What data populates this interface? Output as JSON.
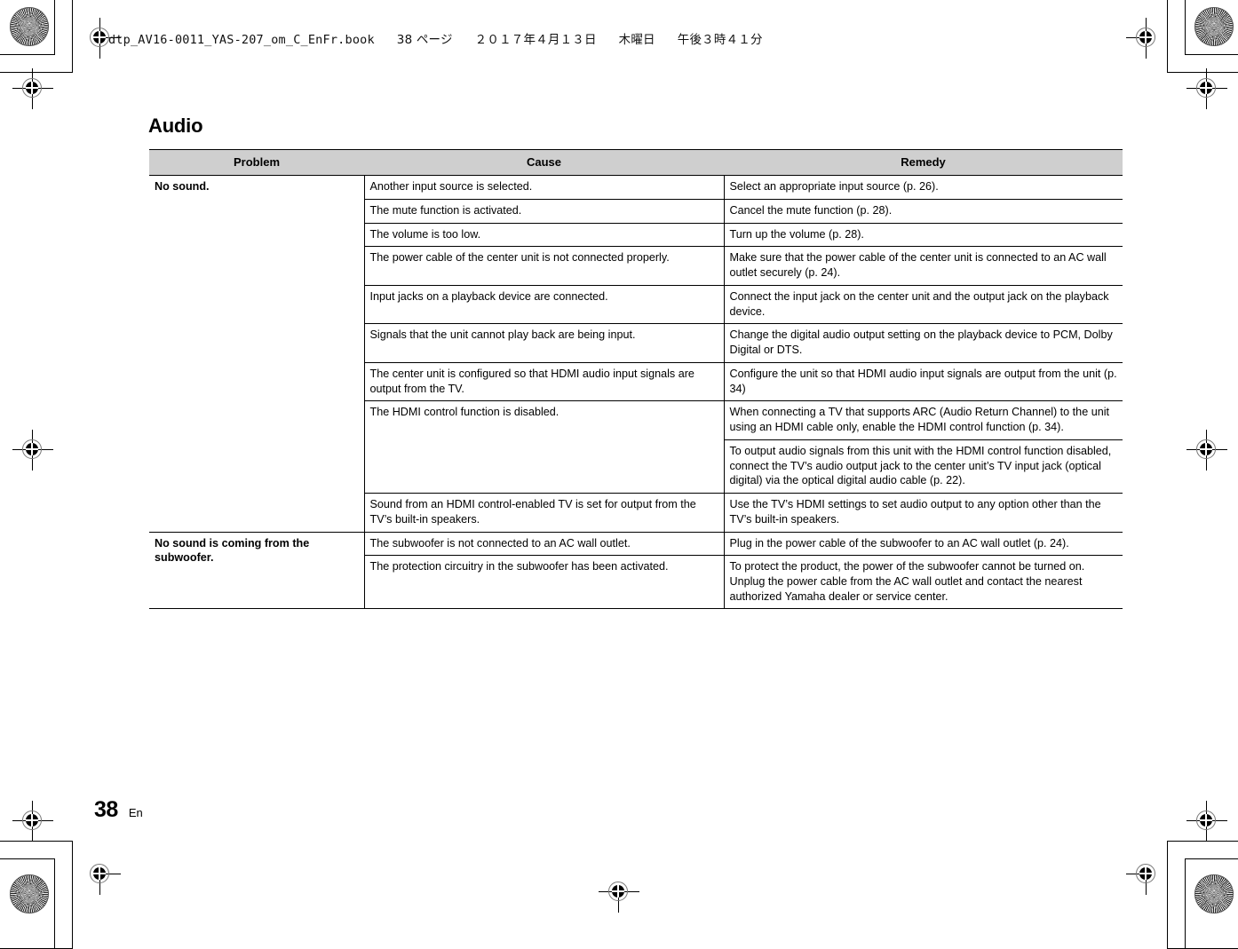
{
  "print_header": {
    "filename": "dtp_AV16-0011_YAS-207_om_C_EnFr.book",
    "page_marker": "38 ページ",
    "date": "２０１７年４月１３日",
    "weekday": "木曜日",
    "time": "午後３時４１分"
  },
  "heading": "Audio",
  "table": {
    "columns": [
      "Problem",
      "Cause",
      "Remedy"
    ],
    "groups": [
      {
        "problem": "No sound.",
        "rows": [
          {
            "cause": "Another input source is selected.",
            "remedy": "Select an appropriate input source (p. 26)."
          },
          {
            "cause": "The mute function is activated.",
            "remedy": "Cancel the mute function (p. 28)."
          },
          {
            "cause": "The volume is too low.",
            "remedy": "Turn up the volume (p. 28)."
          },
          {
            "cause": "The power cable of the center unit is not connected properly.",
            "remedy": "Make sure that the power cable of the center unit is connected to an AC wall outlet securely (p. 24)."
          },
          {
            "cause": "Input jacks on a playback device are connected.",
            "remedy": "Connect the input jack on the center unit and the output jack on the playback device."
          },
          {
            "cause": "Signals that the unit cannot play back are being input.",
            "remedy": "Change the digital audio output setting on the playback device to PCM, Dolby Digital or DTS."
          },
          {
            "cause": "The center unit is configured so that HDMI audio input signals are output from the TV.",
            "remedy": "Configure the unit so that HDMI audio input signals are output from the unit (p. 34)"
          },
          {
            "cause": "The HDMI control function is disabled.",
            "remedy": "When connecting a TV that supports ARC (Audio Return Channel) to the unit using an HDMI cable only, enable the HDMI control function (p. 34).",
            "remedy2": "To output audio signals from this unit with the HDMI control function disabled, connect the TV’s audio output jack to the center unit’s TV input jack (optical digital) via the optical digital audio cable (p. 22)."
          },
          {
            "cause": "Sound from an HDMI control-enabled TV is set for output from the TV’s built-in speakers.",
            "remedy": "Use the TV’s HDMI settings to set audio output to any option other than the TV’s built-in speakers."
          }
        ]
      },
      {
        "problem": "No sound is coming from the subwoofer.",
        "rows": [
          {
            "cause": "The subwoofer is not connected to an AC wall outlet.",
            "remedy": "Plug in the power cable of the subwoofer to an AC wall outlet (p. 24)."
          },
          {
            "cause": "The protection circuitry in the subwoofer has been activated.",
            "remedy": "To protect the product, the power of the subwoofer cannot be turned on. Unplug the power cable from the AC wall outlet and contact the nearest authorized Yamaha dealer or service center."
          }
        ]
      }
    ]
  },
  "footer": {
    "page_number": "38",
    "language": "En"
  },
  "colors": {
    "header_fill": "#cfcfcf",
    "rule": "#000000",
    "text": "#000000"
  }
}
